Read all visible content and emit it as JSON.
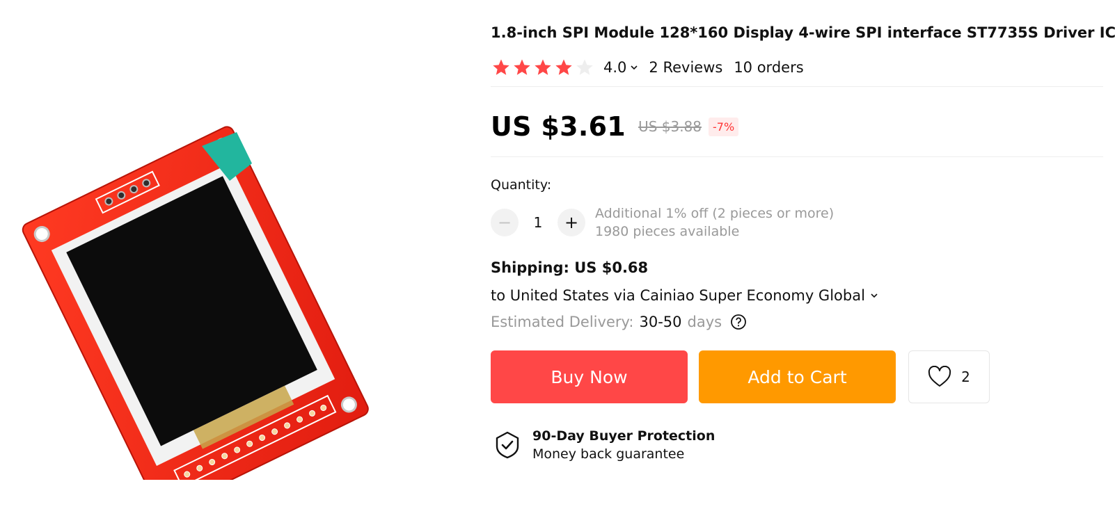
{
  "product": {
    "title": "1.8-inch SPI Module 128*160 Display 4-wire SPI interface ST7735S Driver IC",
    "image_icon": "tft-lcd-module-image"
  },
  "rating": {
    "value": "4.0",
    "stars": 4.0,
    "star_count": 5,
    "reviews": "2 Reviews",
    "orders": "10 orders",
    "star_color": "#ff4747"
  },
  "price": {
    "current": "US $3.61",
    "original": "US $3.88",
    "discount": "-7%"
  },
  "quantity": {
    "label": "Quantity:",
    "value": "1",
    "minus_symbol": "−",
    "plus_symbol": "+",
    "promo": "Additional 1% off (2 pieces or more)",
    "available": "1980 pieces available"
  },
  "shipping": {
    "title": "Shipping: US $0.68",
    "destination": "to United States via Cainiao Super Economy Global",
    "estimated_label": "Estimated Delivery:",
    "days_value": "30-50",
    "days_unit": "days"
  },
  "actions": {
    "buy_now": "Buy Now",
    "add_to_cart": "Add to Cart",
    "wishlist_count": "2",
    "buy_color": "#ff4747",
    "cart_color": "#ff9900"
  },
  "protection": {
    "title": "90-Day Buyer Protection",
    "subtitle": "Money back guarantee"
  }
}
